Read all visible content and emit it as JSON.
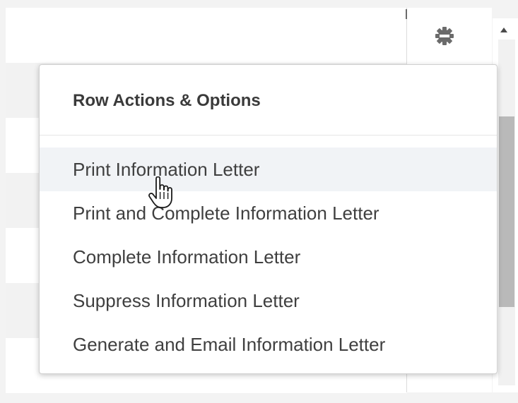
{
  "menu": {
    "title": "Row Actions & Options",
    "items": [
      {
        "label": "Print Information Letter",
        "hovered": true
      },
      {
        "label": "Print and Complete Information Letter",
        "hovered": false
      },
      {
        "label": "Complete Information Letter",
        "hovered": false
      },
      {
        "label": "Suppress Information Letter",
        "hovered": false
      },
      {
        "label": "Generate and Email Information Letter",
        "hovered": false
      }
    ]
  },
  "grid": {
    "settings_icon": "gear-icon",
    "scroll_up_icon": "triangle-up-icon"
  },
  "cursor": {
    "icon": "hand-pointer-icon"
  },
  "colors": {
    "hover_background": "#f1f3f6",
    "menu_text": "#3f3f3f",
    "title_text": "#3a3a3a",
    "gear": "#6b6b6b",
    "scroll_thumb": "#b9b9b9"
  }
}
